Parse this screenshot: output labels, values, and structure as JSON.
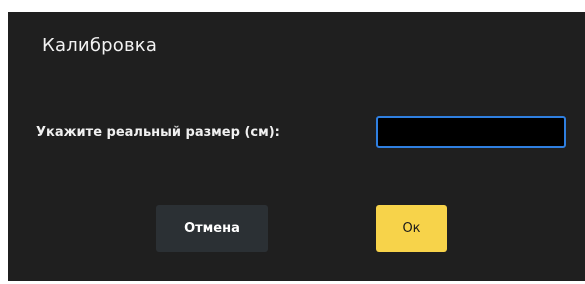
{
  "dialog": {
    "title": "Калибровка",
    "field_label": "Укажите реальный размер (см):",
    "input_value": "",
    "cancel_label": "Отмена",
    "ok_label": "Ок"
  },
  "colors": {
    "dialog_background": "#1f1f1f",
    "input_border": "#2f7fe0",
    "cancel_button": "#2b3034",
    "ok_button": "#f7d34a"
  }
}
